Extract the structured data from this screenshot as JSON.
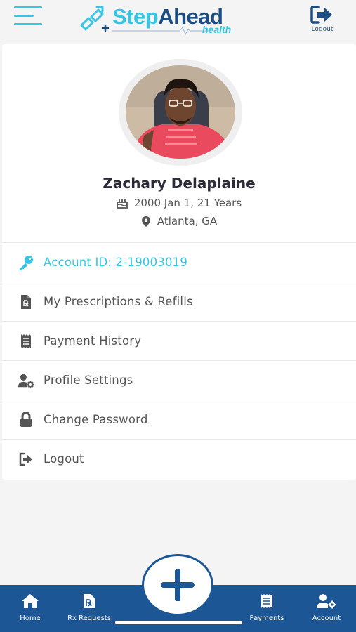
{
  "app": {
    "logo_step": "Step",
    "logo_ahead": "Ahead",
    "logo_sub": "health",
    "logout_label": "Logout",
    "brand_light": "#36c6e4",
    "brand_dark": "#1c5694"
  },
  "profile": {
    "name": "Zachary Delaplaine",
    "birth": "2000 Jan 1, 21 Years",
    "location": "Atlanta, GA"
  },
  "menu": [
    {
      "label": "Account ID: 2-19003019",
      "icon": "key-icon"
    },
    {
      "label": "My Prescriptions & Refills",
      "icon": "prescription-file-icon"
    },
    {
      "label": "Payment History",
      "icon": "receipt-icon"
    },
    {
      "label": "Profile Settings",
      "icon": "user-gear-icon"
    },
    {
      "label": "Change Password",
      "icon": "lock-icon"
    },
    {
      "label": "Logout",
      "icon": "logout-icon"
    }
  ],
  "bottom_nav": [
    {
      "label": "Home",
      "icon": "home-icon"
    },
    {
      "label": "Rx Requests",
      "icon": "rx-icon"
    },
    {
      "label": "Payments",
      "icon": "receipt-icon"
    },
    {
      "label": "Account",
      "icon": "user-gear-icon"
    }
  ]
}
